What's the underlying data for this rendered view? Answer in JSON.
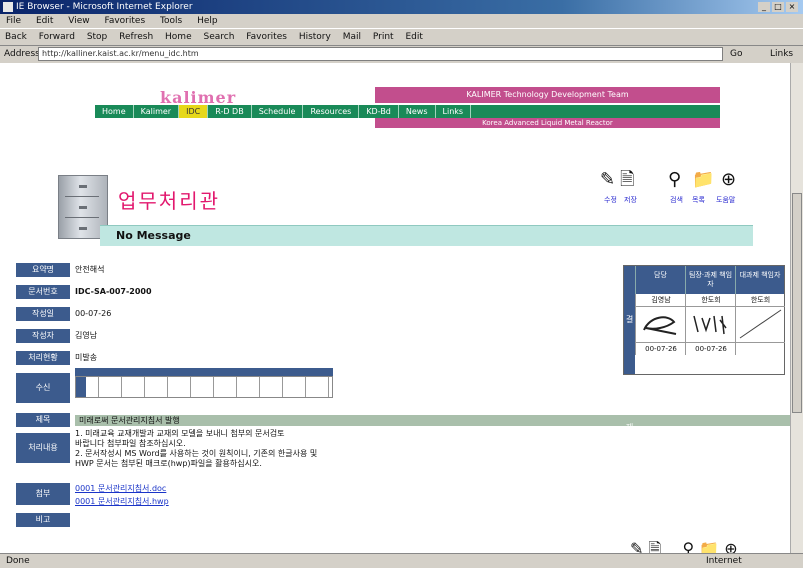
{
  "window": {
    "title": "IE Browser - Microsoft Internet Explorer"
  },
  "menu": [
    "File",
    "Edit",
    "View",
    "Favorites",
    "Tools",
    "Help"
  ],
  "toolbar": [
    "Back",
    "Forward",
    "Stop",
    "Refresh",
    "Home",
    "Search",
    "Favorites",
    "History",
    "Mail",
    "Print",
    "Edit"
  ],
  "address": {
    "label": "Address",
    "url": "http://kalliner.kaist.ac.kr/menu_idc.htm",
    "go": "Go",
    "links": "Links"
  },
  "site": {
    "logo": "kalimer",
    "banner": "KALIMER Technology Development Team",
    "subbanner": "Korea Advanced Liquid Metal Reactor",
    "nav": [
      "Home",
      "Kalimer",
      "IDC",
      "R-D DB",
      "Schedule",
      "Resources",
      "KD-Bd",
      "News",
      "Links"
    ],
    "nav_highlight": "IDC"
  },
  "page": {
    "title": "업무처리관",
    "message": "No Message"
  },
  "icons_top": [
    {
      "name": "edit-icon",
      "glyph": "✎",
      "caption": "수정"
    },
    {
      "name": "save-icon",
      "glyph": "🗎",
      "caption": "저장"
    },
    {
      "name": "search-icon",
      "glyph": "⚲",
      "caption": "검색"
    },
    {
      "name": "folder-icon",
      "glyph": "📁",
      "caption": "목록"
    },
    {
      "name": "globe-icon",
      "glyph": "⊕",
      "caption": "도움말"
    }
  ],
  "form": {
    "rows": [
      {
        "label": "요약명",
        "value": "안전해석",
        "bold": false
      },
      {
        "label": "문서번호",
        "value": "IDC-SA-007-2000",
        "bold": true
      },
      {
        "label": "작성일",
        "value": "00-07-26",
        "bold": false
      },
      {
        "label": "작성자",
        "value": "김영남",
        "bold": false
      },
      {
        "label": "처리현황",
        "value": "미발송",
        "bold": false
      }
    ],
    "recipient_label": "수신",
    "subject_label": "제목",
    "subject": "미래로써 문서관리지침서 발행",
    "body_label": "처리내용",
    "body_lines": [
      "1. 미래교육 교재개발과 교재의 모델을 보내니 첨부의 문서검토",
      "바랍니다 첨부파일 참조하십시오.",
      "2. 문서작성시 MS Word를 사용하는 것이 원칙이니, 기존의 한글사용 및",
      "HWP 문서는 첨부된 매크로(hwp)파일을 활용하십시오."
    ],
    "attach_label": "첨부",
    "attachments": [
      "0001 문서관리지침서.doc",
      "0001 문서관리지침서.hwp"
    ],
    "note_label": "비고"
  },
  "approval": {
    "side_label": "결재",
    "headers": [
      "담당",
      "팀장·과제 책임자",
      "대과제 책임자"
    ],
    "names": [
      "김영남",
      "한도희",
      "한도희"
    ],
    "dates": [
      "00-07-26",
      "00-07-26",
      ""
    ]
  },
  "status": {
    "left": "Done",
    "right": "Internet"
  }
}
